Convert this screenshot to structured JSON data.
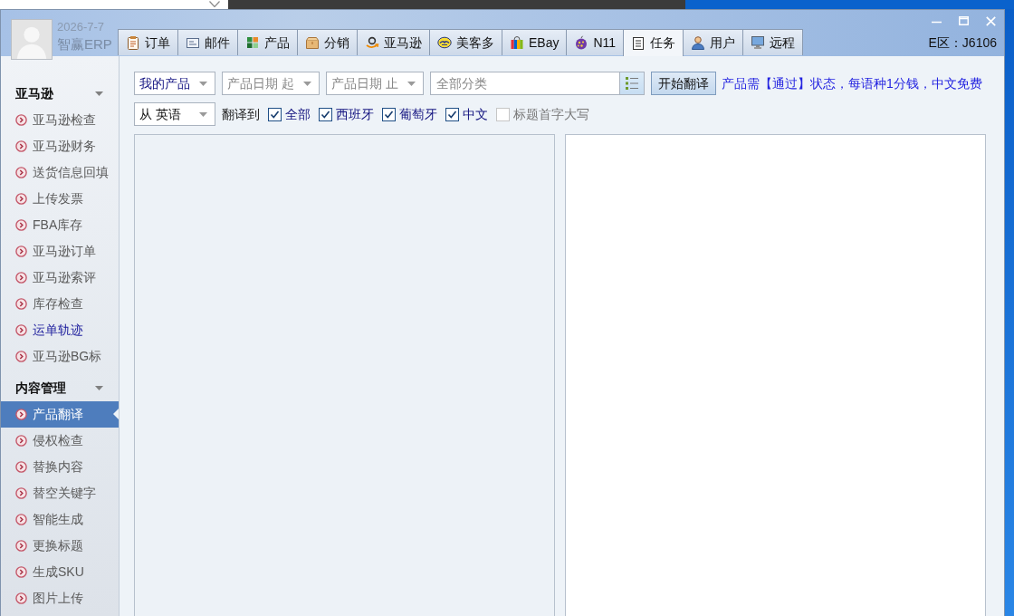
{
  "header": {
    "date": "2026-7-7",
    "app_name": "智赢ERP",
    "region": "E区：J6106"
  },
  "tabs": [
    {
      "label": "订单",
      "selected": false
    },
    {
      "label": "邮件",
      "selected": false
    },
    {
      "label": "产品",
      "selected": false
    },
    {
      "label": "分销",
      "selected": false
    },
    {
      "label": "亚马逊",
      "selected": false
    },
    {
      "label": "美客多",
      "selected": false
    },
    {
      "label": "EBay",
      "selected": false
    },
    {
      "label": "N11",
      "selected": false
    },
    {
      "label": "任务",
      "selected": true
    },
    {
      "label": "用户",
      "selected": false
    },
    {
      "label": "远程",
      "selected": false
    }
  ],
  "sidebar": {
    "groups": [
      {
        "title": "亚马逊",
        "expanded": true,
        "items": [
          {
            "label": "亚马逊检查",
            "selected": false,
            "visited": false
          },
          {
            "label": "亚马逊财务",
            "selected": false,
            "visited": false
          },
          {
            "label": "送货信息回填",
            "selected": false,
            "visited": false
          },
          {
            "label": "上传发票",
            "selected": false,
            "visited": false
          },
          {
            "label": "FBA库存",
            "selected": false,
            "visited": false
          },
          {
            "label": "亚马逊订单",
            "selected": false,
            "visited": false
          },
          {
            "label": "亚马逊索评",
            "selected": false,
            "visited": false
          },
          {
            "label": "库存检查",
            "selected": false,
            "visited": false
          },
          {
            "label": "运单轨迹",
            "selected": false,
            "visited": true
          },
          {
            "label": "亚马逊BG标",
            "selected": false,
            "visited": false
          }
        ]
      },
      {
        "title": "内容管理",
        "expanded": true,
        "items": [
          {
            "label": "产品翻译",
            "selected": true,
            "visited": false
          },
          {
            "label": "侵权检查",
            "selected": false,
            "visited": false
          },
          {
            "label": "替换内容",
            "selected": false,
            "visited": false
          },
          {
            "label": "替空关键字",
            "selected": false,
            "visited": false
          },
          {
            "label": "智能生成",
            "selected": false,
            "visited": false
          },
          {
            "label": "更换标题",
            "selected": false,
            "visited": false
          },
          {
            "label": "生成SKU",
            "selected": false,
            "visited": false
          },
          {
            "label": "图片上传",
            "selected": false,
            "visited": false
          }
        ]
      }
    ]
  },
  "toolbar": {
    "product_filter": {
      "value": "我的产品"
    },
    "date_from": {
      "placeholder": "产品日期 起"
    },
    "date_to": {
      "placeholder": "产品日期 止"
    },
    "category": {
      "placeholder": "全部分类"
    },
    "start_button": {
      "label": "开始翻译"
    },
    "notice": "产品需【通过】状态，每语种1分钱，中文免费",
    "source_language": {
      "value": "从 英语"
    },
    "target_label": "翻译到",
    "target_options": [
      {
        "label": "全部",
        "checked": true
      },
      {
        "label": "西班牙",
        "checked": true
      },
      {
        "label": "葡萄牙",
        "checked": true
      },
      {
        "label": "中文",
        "checked": true
      },
      {
        "label": "标题首字大写",
        "checked": false
      }
    ]
  }
}
